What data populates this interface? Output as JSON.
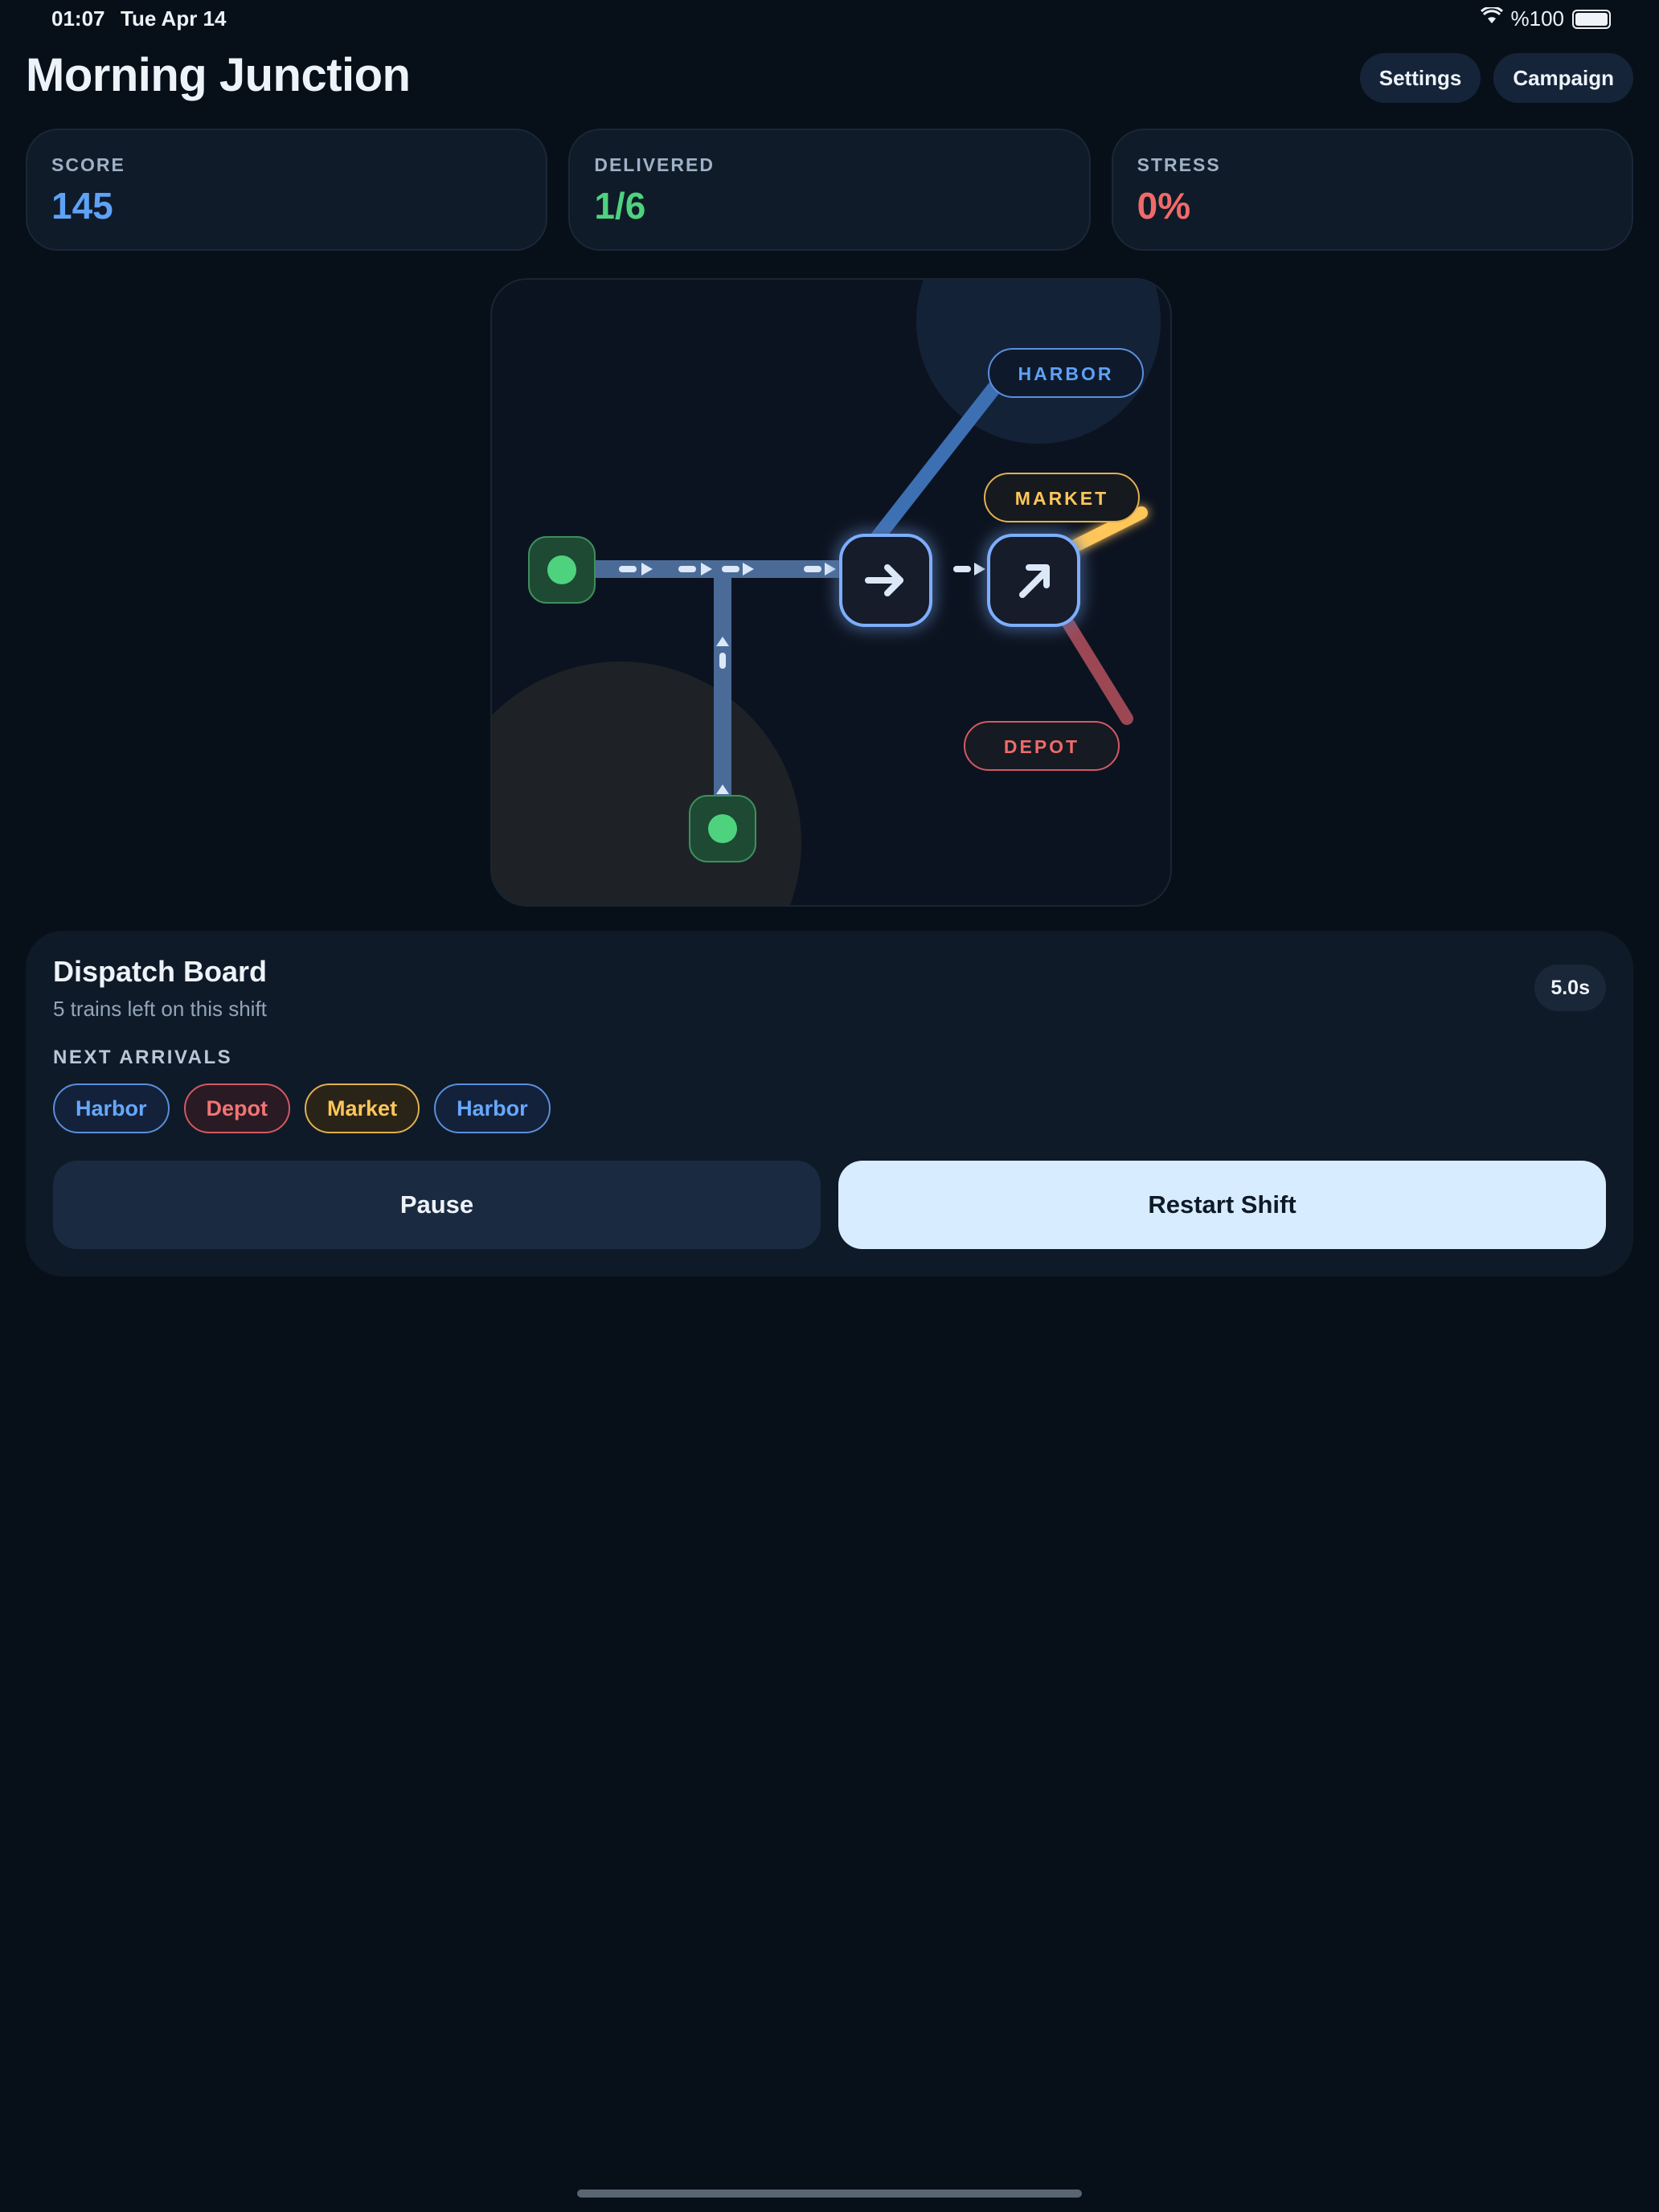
{
  "status_bar": {
    "time": "01:07",
    "date": "Tue Apr 14",
    "battery": "%100"
  },
  "header": {
    "title": "Morning Junction",
    "settings_label": "Settings",
    "campaign_label": "Campaign"
  },
  "stats": [
    {
      "label": "SCORE",
      "value": "145",
      "color": "#5ea2f7"
    },
    {
      "label": "DELIVERED",
      "value": "1/6",
      "color": "#4ed27e"
    },
    {
      "label": "STRESS",
      "value": "0%",
      "color": "#f06a6a"
    }
  ],
  "map": {
    "stations": [
      {
        "label": "HARBOR",
        "color": "#5ea2f7"
      },
      {
        "label": "MARKET",
        "color": "#ffc65a"
      },
      {
        "label": "DEPOT",
        "color": "#f06a6a"
      }
    ],
    "switch_icons": [
      "arrow-right-icon",
      "arrow-up-right-icon"
    ]
  },
  "dispatch": {
    "title": "Dispatch Board",
    "subtitle": "5 trains left on this shift",
    "timer": "5.0s",
    "next_label": "NEXT ARRIVALS",
    "arrivals": [
      "Harbor",
      "Depot",
      "Market",
      "Harbor"
    ],
    "pause_label": "Pause",
    "restart_label": "Restart Shift"
  }
}
